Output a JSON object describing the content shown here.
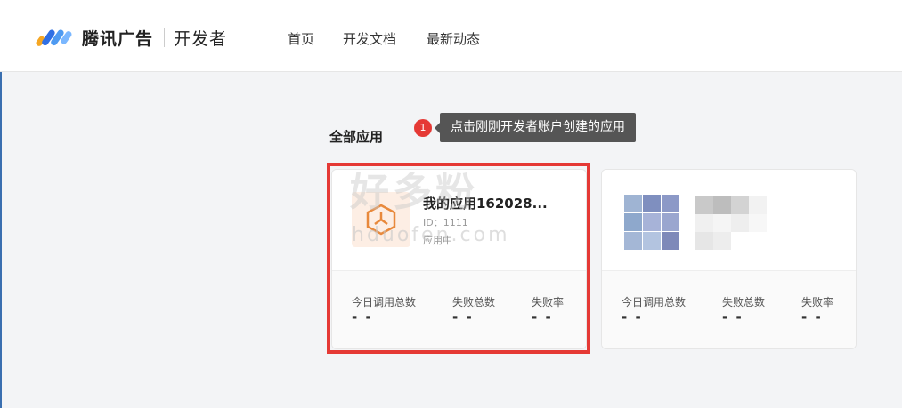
{
  "header": {
    "brand": "腾讯广告",
    "brand_sub": "开发者",
    "nav": [
      {
        "label": "首页"
      },
      {
        "label": "开发文档"
      },
      {
        "label": "最新动态"
      }
    ]
  },
  "section": {
    "title": "全部应用",
    "tip_number": "1",
    "tip_text": "点击刚刚开发者账户创建的应用"
  },
  "apps": [
    {
      "name": "我的应用162028...",
      "id_text": "ID：1111",
      "status": "应用中",
      "stats": [
        {
          "label": "今日调用总数",
          "value": "- -"
        },
        {
          "label": "失败总数",
          "value": "- -"
        },
        {
          "label": "失败率",
          "value": "- -"
        }
      ]
    },
    {
      "stats": [
        {
          "label": "今日调用总数",
          "value": "- -"
        },
        {
          "label": "失败总数",
          "value": "- -"
        },
        {
          "label": "失败率",
          "value": "- -"
        }
      ]
    }
  ],
  "watermark": {
    "main": "好多粉",
    "sub": "hduofen.com"
  },
  "colors": {
    "highlight": "#e53935",
    "tooltip_bg": "#555555",
    "app_icon": "#e8893c"
  },
  "icons": {
    "logo": "tencent-ads-logo",
    "app": "cube-icon"
  }
}
